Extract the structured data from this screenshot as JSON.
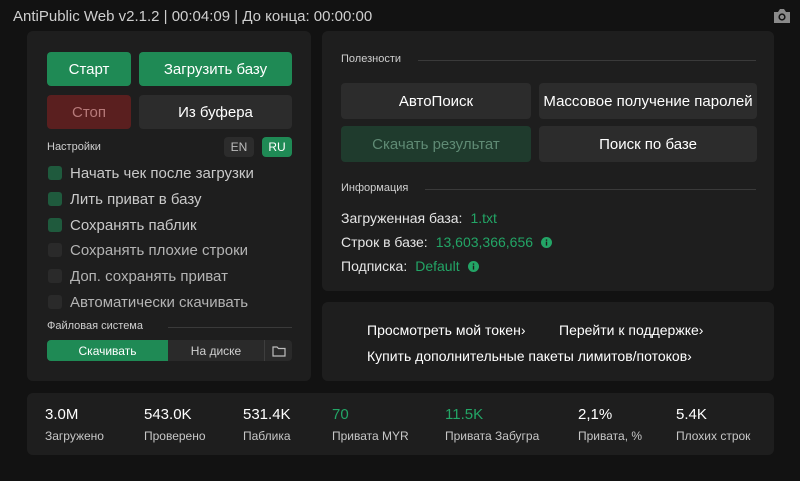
{
  "window": {
    "title": "AntiPublic Web v2.1.2 | 00:04:09 | До конца: 00:00:00"
  },
  "controls": {
    "start": "Старт",
    "load_base": "Загрузить базу",
    "stop": "Стоп",
    "from_clipboard": "Из буфера"
  },
  "settings": {
    "label": "Настройки",
    "lang_en": "EN",
    "lang_ru": "RU",
    "selected_language": "RU",
    "options": [
      {
        "label": "Начать чек после загрузки",
        "checked": true
      },
      {
        "label": "Лить приват в базу",
        "checked": true
      },
      {
        "label": "Сохранять паблик",
        "checked": true
      },
      {
        "label": "Сохранять плохие строки",
        "checked": false
      },
      {
        "label": "Доп. сохранять приват",
        "checked": false
      },
      {
        "label": "Автоматически скачивать",
        "checked": false
      }
    ]
  },
  "filesystem": {
    "label": "Файловая система",
    "download": "Скачивать",
    "on_disk": "На диске",
    "selected": "Скачивать"
  },
  "utilities": {
    "label": "Полезности",
    "autosearch": "АвтоПоиск",
    "mass_passwords": "Массовое получение паролей",
    "download_result": "Скачать результат",
    "search_base": "Поиск по базе"
  },
  "info": {
    "label": "Информация",
    "loaded_base_label": "Загруженная база:",
    "loaded_base_value": "1.txt",
    "lines_label": "Строк в базе:",
    "lines_value": "13,603,366,656",
    "subscription_label": "Подписка:",
    "subscription_value": "Default"
  },
  "links": {
    "view_token": "Просмотреть мой токен",
    "support": "Перейти к поддержке",
    "buy_packages": "Купить дополнительные пакеты лимитов/потоков"
  },
  "stats": [
    {
      "value": "3.0M",
      "label": "Загружено",
      "highlight": false
    },
    {
      "value": "543.0K",
      "label": "Проверено",
      "highlight": false
    },
    {
      "value": "531.4K",
      "label": "Паблика",
      "highlight": false
    },
    {
      "value": "70",
      "label": "Привата MYR",
      "highlight": true
    },
    {
      "value": "11.5K",
      "label": "Привата Забугра",
      "highlight": true
    },
    {
      "value": "2,1%",
      "label": "Привата, %",
      "highlight": false
    },
    {
      "value": "5.4K",
      "label": "Плохих строк",
      "highlight": false
    }
  ],
  "colors": {
    "accent": "#1f8a55",
    "accent_text": "#23a566",
    "background": "#121212",
    "panel": "#1e1e1e"
  },
  "icons": [
    "camera-icon",
    "folder-icon",
    "info-icon",
    "chevron-right-icon"
  ]
}
